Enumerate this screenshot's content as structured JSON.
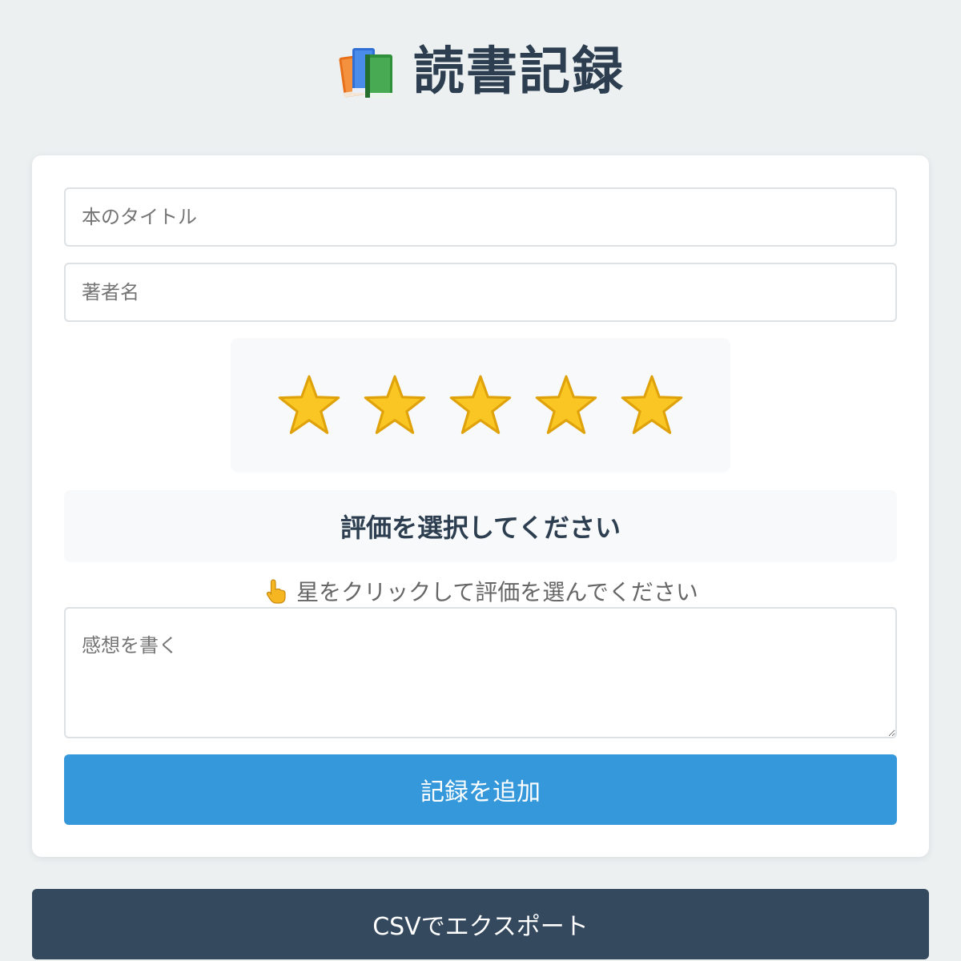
{
  "header": {
    "icon": "books-icon",
    "title": "読書記録"
  },
  "form": {
    "title_placeholder": "本のタイトル",
    "title_value": "",
    "author_placeholder": "著者名",
    "author_value": "",
    "rating": {
      "star_icon": "star-icon",
      "max_stars": 5,
      "star_color": "#f9c623",
      "status_text": "評価を選択してください",
      "hint_icon": "pointing-hand-icon",
      "hint_text": "星をクリックして評価を選んでください"
    },
    "thoughts_placeholder": "感想を書く",
    "thoughts_value": "",
    "add_button_label": "記録を追加"
  },
  "export_button_label": "CSVでエクスポート",
  "colors": {
    "background": "#ecf0f1",
    "title": "#2c3e50",
    "primary_button": "#3498db",
    "secondary_button": "#34495e"
  }
}
